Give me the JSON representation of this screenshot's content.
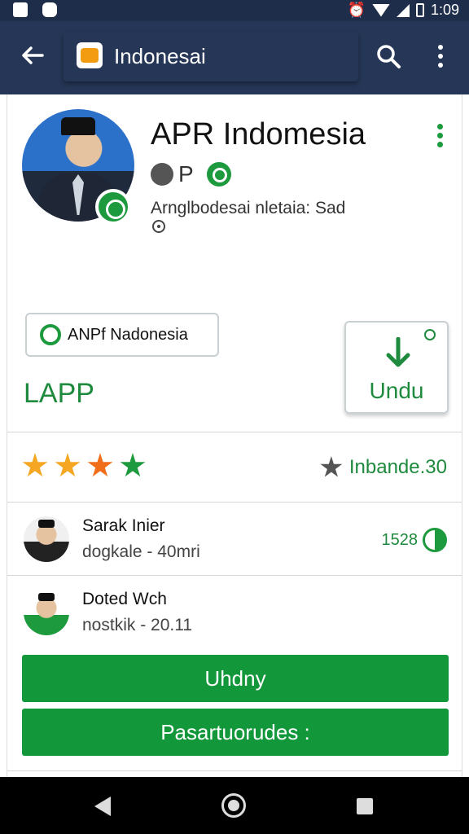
{
  "status_bar": {
    "time": "1:09",
    "icons": [
      "photo-icon",
      "shield-icon",
      "location-icon",
      "alarm-icon",
      "wifi-icon",
      "signal-icon",
      "battery-icon"
    ]
  },
  "toolbar": {
    "title": "Indonesai",
    "icons": [
      "back-arrow-icon",
      "app-mail-icon",
      "search-icon",
      "more-vert-icon"
    ]
  },
  "app": {
    "name": "APR Indomesia",
    "badge_text": "P",
    "category": "Arnglbodesai nletaia: Sad",
    "chip_label": "ANPf Nadonesia",
    "section_label": "LAPP",
    "download_label": "Undu"
  },
  "rating": {
    "stars": [
      {
        "color": "#f5a623"
      },
      {
        "color": "#f5a623"
      },
      {
        "color": "#f06d1a"
      },
      {
        "color": "#1e9a3e"
      }
    ],
    "label": "Inbande.30"
  },
  "reviews": [
    {
      "name": "Sarak Inier",
      "meta": "dogkale - 40mri",
      "count": "1528"
    },
    {
      "name": "Doted Wch",
      "meta": "nostkik - 20.11"
    }
  ],
  "buttons": {
    "primary": "Uhdny",
    "secondary": "Pasartuorudes :"
  },
  "colors": {
    "toolbar": "#253656",
    "accent_green": "#12973a"
  }
}
